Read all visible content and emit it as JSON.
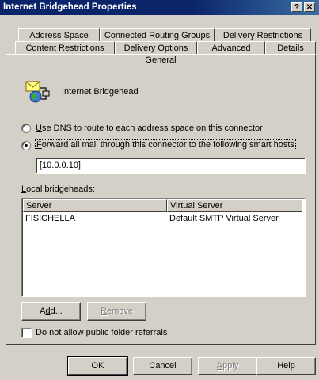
{
  "window": {
    "title": "Internet Bridgehead Properties",
    "help_label": "?",
    "close_label": "✕"
  },
  "tabs": {
    "row1": [
      "Address Space",
      "Connected Routing Groups",
      "Delivery Restrictions"
    ],
    "row2": [
      "Content Restrictions",
      "Delivery Options",
      "Advanced",
      "Details"
    ],
    "active": "General"
  },
  "general": {
    "connector_name": "Internet Bridgehead",
    "connector_icon": "connector-icon",
    "radio_dns": {
      "prefix": "",
      "accel": "U",
      "rest": "se DNS to route to each address space on this connector",
      "selected": false
    },
    "radio_smarthost": {
      "prefix": "",
      "accel": "F",
      "rest": "orward all mail through this connector to the following smart hosts",
      "selected": true
    },
    "smart_hosts_value": "[10.0.0.10]",
    "local_bridgeheads_label": {
      "accel": "L",
      "rest": "ocal bridgeheads:"
    },
    "bridgeheads_table": {
      "columns": [
        "Server",
        "Virtual Server"
      ],
      "rows": [
        {
          "server": "FISICHELLA",
          "virtual_server": "Default SMTP Virtual Server"
        }
      ]
    },
    "add_button": {
      "pre": "A",
      "accel": "d",
      "post": "d..."
    },
    "remove_button": {
      "pre": "",
      "accel": "R",
      "post": "emove",
      "disabled": true
    },
    "public_folder_checkbox": {
      "pre": "Do not allo",
      "accel": "w",
      "post": " public folder referrals",
      "checked": false
    }
  },
  "footer": {
    "ok": "OK",
    "cancel": "Cancel",
    "apply": {
      "accel": "A",
      "rest": "pply",
      "disabled": true
    },
    "help": "Help"
  }
}
